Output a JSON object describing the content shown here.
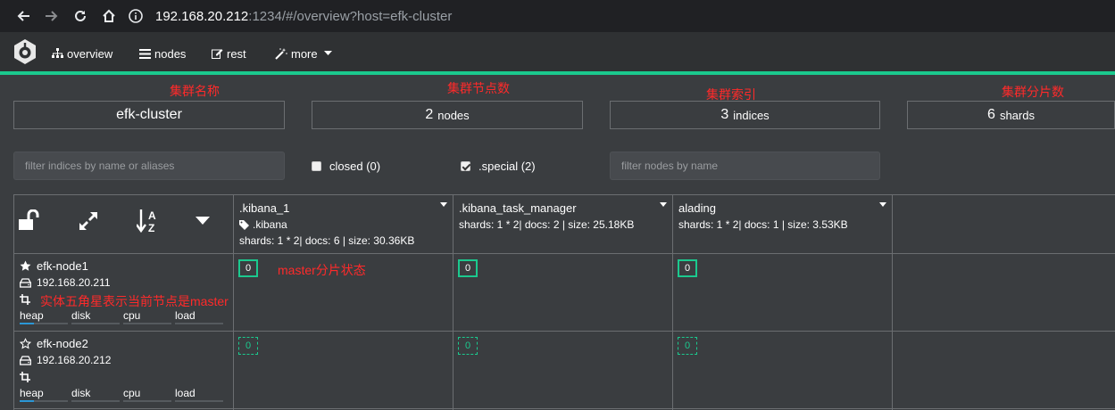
{
  "browser": {
    "url_host": "192.168.20.212",
    "url_rest": ":1234/#/overview?host=efk-cluster"
  },
  "navbar": {
    "items": [
      {
        "label": "overview",
        "icon": "sitemap-icon"
      },
      {
        "label": "nodes",
        "icon": "list-icon"
      },
      {
        "label": "rest",
        "icon": "edit-icon"
      },
      {
        "label": "more",
        "icon": "magic-wand-icon"
      }
    ]
  },
  "annotations": {
    "cluster_name": "集群名称",
    "cluster_nodes": "集群节点数",
    "cluster_indices": "集群索引",
    "cluster_shards": "集群分片数",
    "master_shard_state": "master分片状态",
    "master_star": "实体五角星表示当前节点是master"
  },
  "stats": {
    "cluster_name": "efk-cluster",
    "nodes_count": "2",
    "nodes_unit": "nodes",
    "indices_count": "3",
    "indices_unit": "indices",
    "shards_count": "6",
    "shards_unit": "shards"
  },
  "filters": {
    "indices_placeholder": "filter indices by name or aliases",
    "closed_label": "closed (0)",
    "closed_checked": false,
    "special_label": ".special (2)",
    "special_checked": true,
    "nodes_placeholder": "filter nodes by name"
  },
  "indices": [
    {
      "name": ".kibana_1",
      "alias": ".kibana",
      "info": "shards: 1 * 2| docs: 6 | size: 30.36KB"
    },
    {
      "name": ".kibana_task_manager",
      "alias": "",
      "info": "shards: 1 * 2| docs: 2 | size: 25.18KB"
    },
    {
      "name": "alading",
      "alias": "",
      "info": "shards: 1 * 2| docs: 1 | size: 3.53KB"
    }
  ],
  "nodes": [
    {
      "name": "efk-node1",
      "ip": "192.168.20.211",
      "is_master": true,
      "metrics": {
        "heap": "heap",
        "disk": "disk",
        "cpu": "cpu",
        "load": "load"
      },
      "heap_usage": 0.3,
      "shards": [
        "0",
        "0",
        "0"
      ]
    },
    {
      "name": "efk-node2",
      "ip": "192.168.20.212",
      "is_master": false,
      "metrics": {
        "heap": "heap",
        "disk": "disk",
        "cpu": "cpu",
        "load": "load"
      },
      "heap_usage": 0.3,
      "shards": [
        "0",
        "0",
        "0"
      ]
    }
  ],
  "colors": {
    "accent": "#1bc98e",
    "annotation": "#ff2a2a",
    "background": "#3a3d40"
  }
}
